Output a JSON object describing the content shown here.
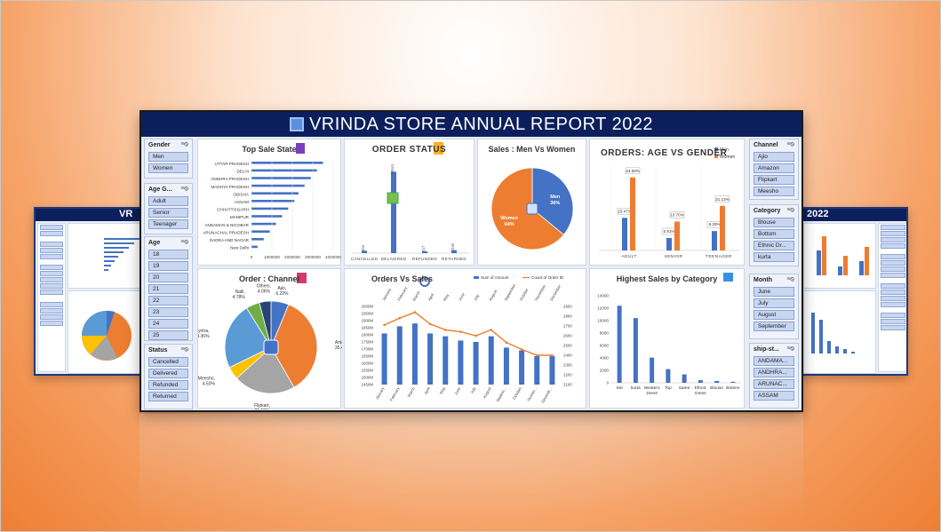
{
  "title": "VRINDA STORE ANNUAL REPORT 2022",
  "side_title_left": "VR",
  "side_title_right": "2022",
  "slicers_left": [
    {
      "name": "Gender",
      "items": [
        "Men",
        "Women"
      ]
    },
    {
      "name": "Age G...",
      "items": [
        "Adult",
        "Senior",
        "Teenager"
      ]
    },
    {
      "name": "Age",
      "items": [
        "18",
        "19",
        "20",
        "21",
        "22",
        "23",
        "24",
        "25"
      ]
    },
    {
      "name": "Status",
      "items": [
        "Cancelled",
        "Delivered",
        "Refunded",
        "Returned"
      ]
    }
  ],
  "slicers_right": [
    {
      "name": "Channel",
      "items": [
        "Ajio",
        "Amazon",
        "Flipkart",
        "Meesho"
      ]
    },
    {
      "name": "Category",
      "items": [
        "Blouse",
        "Bottom",
        "Ethnic Dr...",
        "kurta"
      ]
    },
    {
      "name": "Month",
      "items": [
        "June",
        "July",
        "August",
        "September"
      ]
    },
    {
      "name": "ship-st...",
      "items": [
        "ANDAMA...",
        "ANDHRA...",
        "ARUNAC...",
        "ASSAM"
      ]
    }
  ],
  "panels": {
    "top_sale_state": "Top Sale State",
    "order_status": "ORDER STATUS",
    "sales_men_women": "Sales : Men Vs Women",
    "age_gender": "ORDERS: AGE VS GENDER",
    "order_channel": "Order : Channel",
    "orders_vs_sales": "Orders Vs Sales",
    "highest_category": "Highest Sales by Category"
  },
  "chart_data": [
    {
      "type": "bar",
      "title": "Top Sale State",
      "orientation": "horizontal",
      "categories": [
        "UTTAR PRADESH",
        "DELHI",
        "ANDHRA PRADESH",
        "MADHYA PRADESH",
        "ODISHA",
        "ASSAM",
        "CHHATTISGARH",
        "MANIPUR",
        "ANDAMAN & NICOBAR",
        "ARUNACHAL PRADESH",
        "DADRA AND NAGAR",
        "New Delhi"
      ],
      "values": [
        3500000,
        3200000,
        2900000,
        2600000,
        2300000,
        2100000,
        1800000,
        1500000,
        1200000,
        900000,
        600000,
        300000
      ],
      "xticks": [
        "0",
        "1000000",
        "2000000",
        "3000000",
        "4000000"
      ],
      "xlim": [
        0,
        4000000
      ]
    },
    {
      "type": "bar",
      "title": "ORDER STATUS",
      "categories": [
        "CANCELLED",
        "DELIVERED",
        "REFUNDED",
        "RETURNED"
      ],
      "values": [
        844,
        28641,
        517,
        1045
      ],
      "data_labels": [
        "844",
        "28641",
        "517",
        "1045"
      ]
    },
    {
      "type": "pie",
      "title": "Sales : Men Vs Women",
      "labels": [
        "Men",
        "Women"
      ],
      "values": [
        36,
        64
      ],
      "data_labels": [
        "Men\n36%",
        "Women\n64%"
      ],
      "colors": [
        "#4472c4",
        "#ed7d31"
      ]
    },
    {
      "type": "bar",
      "title": "ORDERS: AGE VS GENDER",
      "categories": [
        "ADULT",
        "SENIOR",
        "TEENAGER"
      ],
      "series": [
        {
          "name": "Men",
          "values": [
            15.47,
            5.91,
            9.2
          ],
          "color": "#4472c4"
        },
        {
          "name": "Women",
          "values": [
            34.59,
            13.7,
            21.13
          ],
          "color": "#ed7d31"
        }
      ],
      "data_labels": [
        [
          "15.47%",
          "5.91%",
          "9.20%"
        ],
        [
          "34.59%",
          "13.70%",
          "21.13%"
        ]
      ],
      "legend": "top-right"
    },
    {
      "type": "pie",
      "title": "Order : Channel",
      "labels": [
        "Ajio",
        "Amazon",
        "Flipkart",
        "Meesho",
        "Myntra",
        "Nalli",
        "Others"
      ],
      "values": [
        6.22,
        35.48,
        21.59,
        4.5,
        23.36,
        4.78,
        4.06
      ],
      "data_labels": [
        "Ajio, 6.22%",
        "Amazon, 35.48%",
        "Flipkart, 21.59%",
        "Meesho, 4.50%",
        "Myntra, 23.36%",
        "Nalli, 4.78%",
        "Others, 4.06%"
      ],
      "colors": [
        "#4472c4",
        "#ed7d31",
        "#a5a5a5",
        "#ffc000",
        "#5b9bd5",
        "#70ad47",
        "#264478"
      ]
    },
    {
      "type": "bar",
      "title": "Orders Vs Sales",
      "categories": [
        "January",
        "February",
        "March",
        "April",
        "May",
        "June",
        "July",
        "August",
        "Septem...",
        "October",
        "Novem...",
        "Decemb..."
      ],
      "top_categories": [
        "January",
        "February",
        "March",
        "April",
        "May",
        "June",
        "July",
        "August",
        "September",
        "October",
        "November",
        "December"
      ],
      "series": [
        {
          "name": "Sum of Amount",
          "type": "bar",
          "values": [
            1810,
            1860,
            1880,
            1810,
            1790,
            1760,
            1750,
            1790,
            1710,
            1690,
            1650,
            1650
          ]
        },
        {
          "name": "Count of Order ID",
          "type": "line",
          "values": [
            2710,
            2780,
            2840,
            2720,
            2660,
            2640,
            2600,
            2660,
            2530,
            2460,
            2400,
            2400
          ]
        }
      ],
      "yticks_left": [
        "1450M",
        "1500M",
        "1550M",
        "1600M",
        "1650M",
        "1700M",
        "1750M",
        "1800M",
        "1850M",
        "1900M",
        "1950M",
        "2000M"
      ],
      "yticks_right": [
        "2100",
        "2200",
        "2300",
        "2400",
        "2500",
        "2600",
        "2700",
        "2800",
        "2900"
      ],
      "ylim": [
        1450,
        2000
      ],
      "ylim_right": [
        2100,
        2900
      ],
      "legend": "top"
    },
    {
      "type": "bar",
      "title": "Highest Sales by Category",
      "categories": [
        "Set",
        "kurta",
        "Western Dress",
        "Top",
        "Saree",
        "Ethnic Dress",
        "Blouse",
        "Bottom"
      ],
      "values": [
        12400,
        10400,
        4050,
        2200,
        1350,
        420,
        300,
        170
      ],
      "yticks": [
        "0",
        "2000",
        "4000",
        "6000",
        "8000",
        "10000",
        "12000",
        "14000"
      ],
      "ylim": [
        0,
        14000
      ]
    }
  ]
}
